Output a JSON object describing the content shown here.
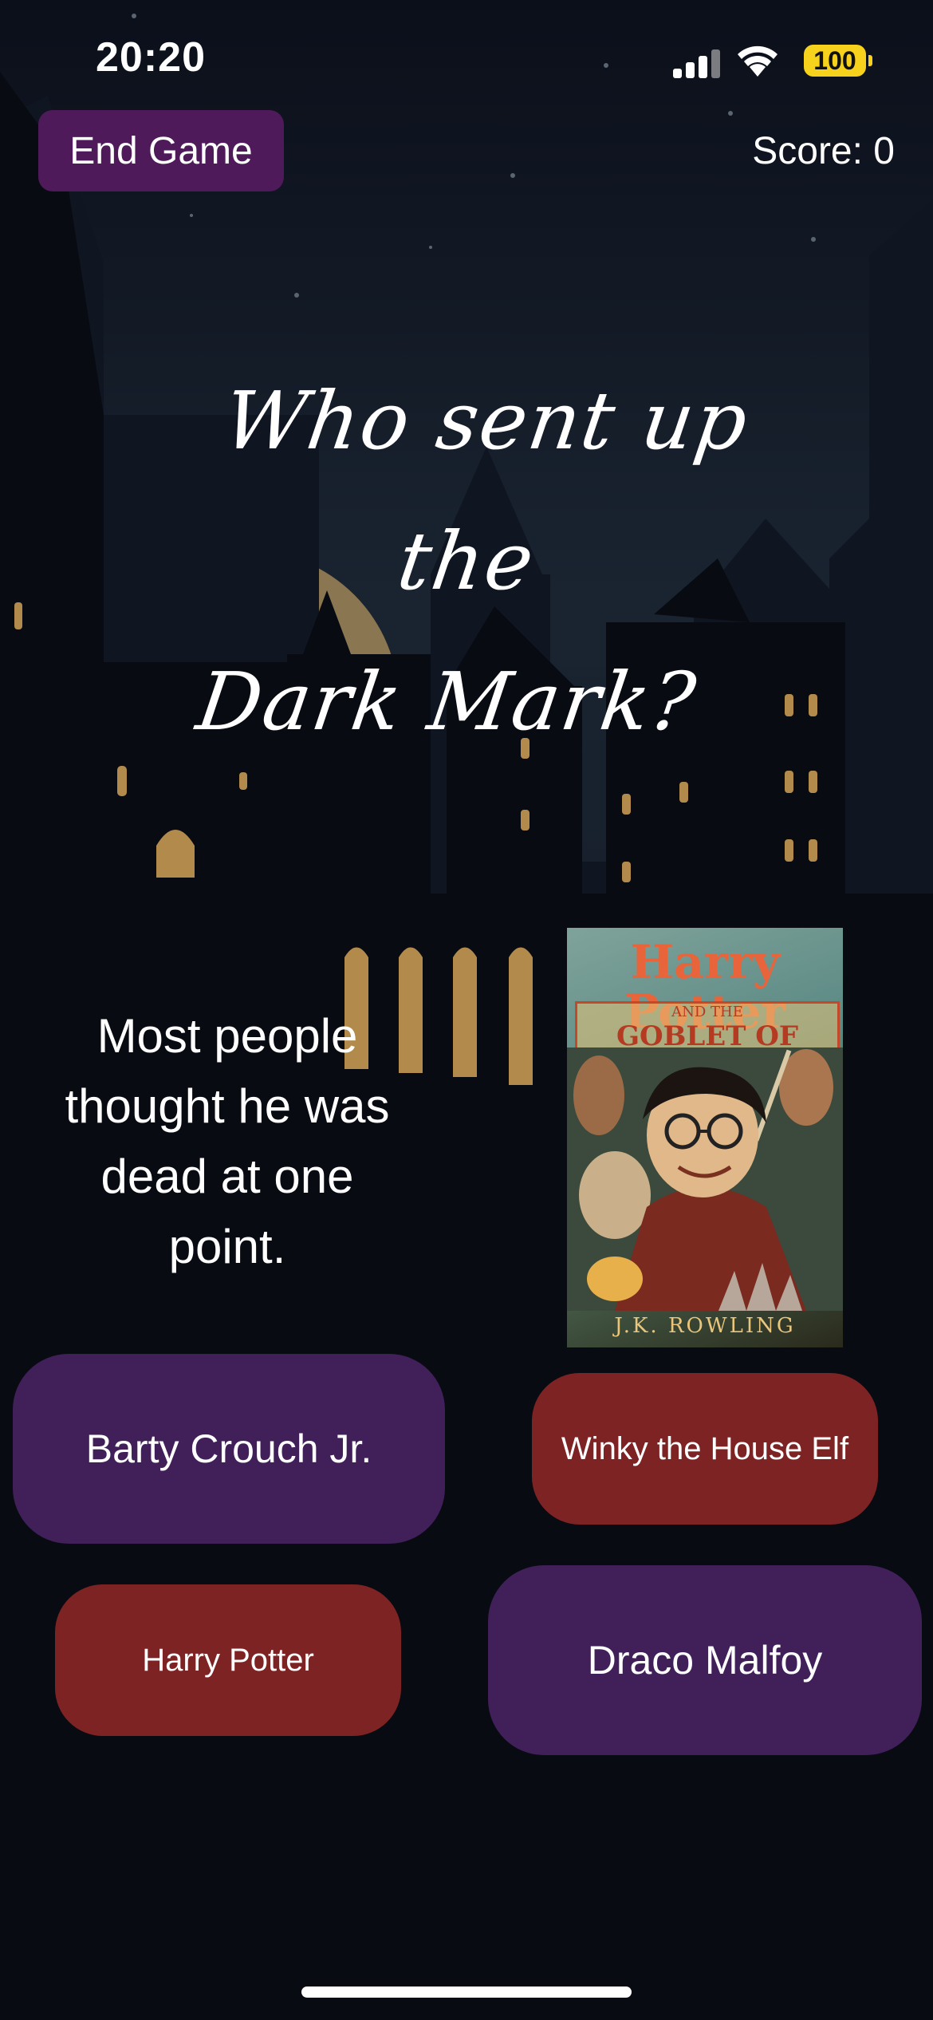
{
  "status_bar": {
    "time": "20:20",
    "battery": "100",
    "icons": [
      "cellular-signal-icon",
      "wifi-icon",
      "battery-icon"
    ]
  },
  "header": {
    "end_game_label": "End Game",
    "score_text": "Score: 0"
  },
  "question": {
    "line1": "Who sent up the",
    "line2": "Dark Mark?"
  },
  "hint": {
    "text": "Most people thought he was dead at one point."
  },
  "book_cover": {
    "title": "Harry Potter",
    "subtitle_small": "AND THE",
    "subtitle": "GOBLET OF FIRE",
    "author": "J.K. ROWLING"
  },
  "answers": [
    {
      "label": "Barty Crouch Jr."
    },
    {
      "label": "Winky the House Elf"
    },
    {
      "label": "Harry Potter"
    },
    {
      "label": "Draco Malfoy"
    }
  ],
  "colors": {
    "background": "#060811",
    "end_button": "#4e1a5a",
    "purple_answer": "#41205a",
    "red_answer": "#7e2323",
    "moon": "#8a7650",
    "window_light": "#b28a4c"
  }
}
